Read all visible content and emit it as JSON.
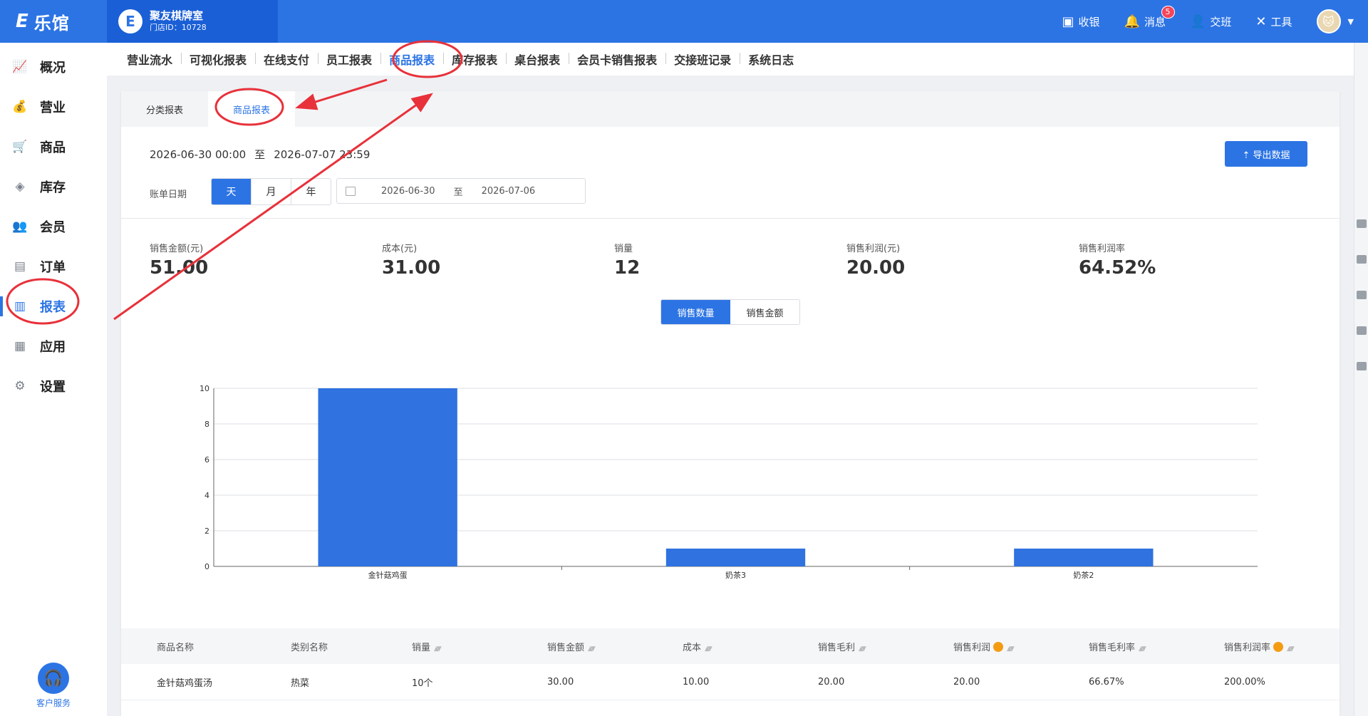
{
  "app": {
    "logo_mark": "E",
    "logo_text": "乐馆"
  },
  "store": {
    "icon": "E",
    "name": "聚友棋牌室",
    "id_text": "门店ID：10728"
  },
  "top_actions": [
    {
      "label": "收银",
      "icon": "cash-register-icon",
      "glyph": "▣"
    },
    {
      "label": "消息",
      "icon": "bell-icon",
      "glyph": "🔔",
      "badge": "5"
    },
    {
      "label": "交班",
      "icon": "handover-icon",
      "glyph": "👤"
    },
    {
      "label": "工具",
      "icon": "tools-icon",
      "glyph": "✕"
    }
  ],
  "avatar_caret": "▼",
  "sidebar": {
    "items": [
      {
        "label": "概况",
        "icon": "overview-chart-icon",
        "glyph": "📈"
      },
      {
        "label": "营业",
        "icon": "money-bag-icon",
        "glyph": "💰"
      },
      {
        "label": "商品",
        "icon": "cart-icon",
        "glyph": "🛒"
      },
      {
        "label": "库存",
        "icon": "layers-icon",
        "glyph": "◈"
      },
      {
        "label": "会员",
        "icon": "members-icon",
        "glyph": "👥"
      },
      {
        "label": "订单",
        "icon": "order-icon",
        "glyph": "▤"
      },
      {
        "label": "报表",
        "icon": "bar-chart-icon",
        "glyph": "▥",
        "active": true
      },
      {
        "label": "应用",
        "icon": "apps-icon",
        "glyph": "▦"
      },
      {
        "label": "设置",
        "icon": "gear-icon",
        "glyph": "⚙"
      }
    ],
    "support_label": "客户服务"
  },
  "report_tabs": [
    "营业流水",
    "可视化报表",
    "在线支付",
    "员工报表",
    "商品报表",
    "库存报表",
    "桌台报表",
    "会员卡销售报表",
    "交接班记录",
    "系统日志"
  ],
  "report_tabs_active": 4,
  "subtabs": [
    "分类报表",
    "商品报表"
  ],
  "date_range": {
    "start": "2026-06-30 00:00",
    "sep": "至",
    "end": "2026-07-07 23:59"
  },
  "export_label": "⇡ 导出数据",
  "bill_date_label": "账单日期",
  "period_buttons": [
    "天",
    "月",
    "年"
  ],
  "date_input": {
    "from": "2026-06-30",
    "sep": "至",
    "to": "2026-07-06"
  },
  "stats": [
    {
      "label": "销售金额(元)",
      "value": "51.00"
    },
    {
      "label": "成本(元)",
      "value": "31.00"
    },
    {
      "label": "销量",
      "value": "12"
    },
    {
      "label": "销售利润(元)",
      "value": "20.00"
    },
    {
      "label": "销售利润率",
      "value": "64.52%"
    }
  ],
  "chart_toggle": [
    "销售数量",
    "销售金额"
  ],
  "chart_data": {
    "type": "bar",
    "categories": [
      "金针菇鸡蛋",
      "奶茶3",
      "奶茶2"
    ],
    "values": [
      10,
      1,
      1
    ],
    "ylim": [
      0,
      10
    ],
    "yticks": [
      0,
      2,
      4,
      6,
      8,
      10
    ],
    "grid": true,
    "color": "#2f72e0"
  },
  "table": {
    "headers": [
      {
        "label": "商品名称"
      },
      {
        "label": "类别名称"
      },
      {
        "label": "销量",
        "sort": true
      },
      {
        "label": "销售金额",
        "sort": true
      },
      {
        "label": "成本",
        "sort": true
      },
      {
        "label": "销售毛利",
        "sort": true
      },
      {
        "label": "销售利润",
        "sort": true,
        "tip": true
      },
      {
        "label": "销售毛利率",
        "sort": true
      },
      {
        "label": "销售利润率",
        "sort": true,
        "tip": true
      }
    ],
    "rows": [
      [
        "金针菇鸡蛋汤",
        "热菜",
        "10个",
        "30.00",
        "10.00",
        "20.00",
        "20.00",
        "66.67%",
        "200.00%"
      ]
    ]
  },
  "colors": {
    "primary": "#2c74e4",
    "annotation": "#e8313a"
  }
}
